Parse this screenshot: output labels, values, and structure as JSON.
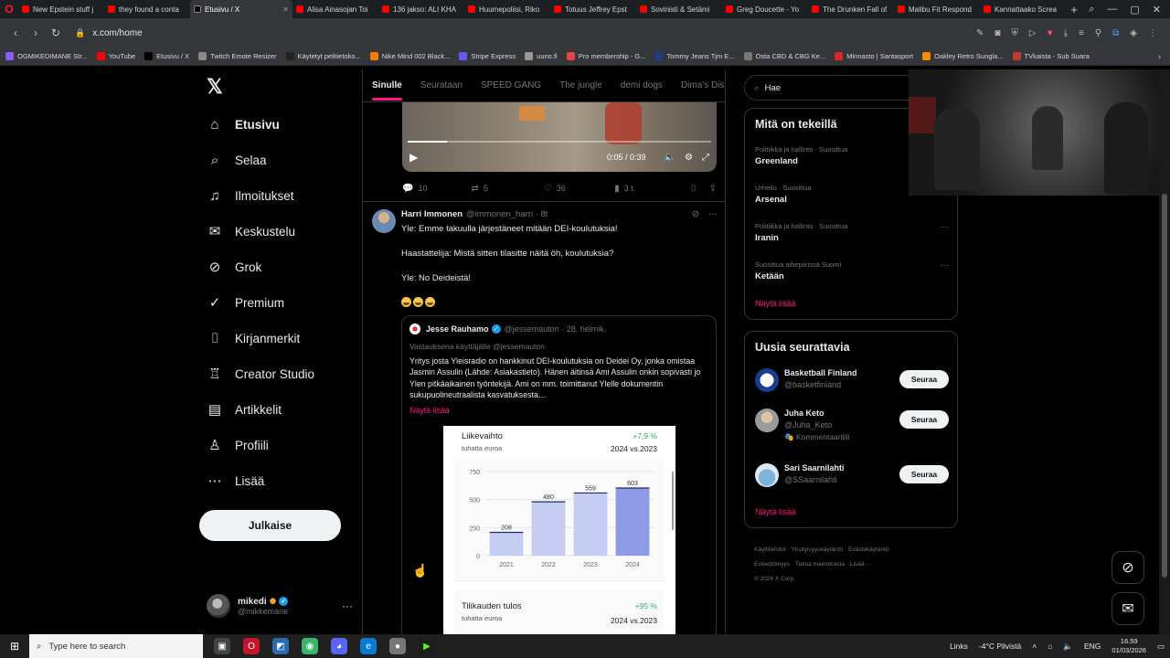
{
  "browser": {
    "tabs": [
      {
        "title": "New Epstein stuff j",
        "favicon": "youtube-icon",
        "active": false
      },
      {
        "title": "they found a conta",
        "favicon": "youtube-icon",
        "active": false
      },
      {
        "title": "Etusivu / X",
        "favicon": "x-icon",
        "active": true
      },
      {
        "title": "Alisa Ainasojan Toi",
        "favicon": "youtube-icon",
        "active": false
      },
      {
        "title": "136 jakso: ALI KHA",
        "favicon": "youtube-icon",
        "active": false
      },
      {
        "title": "Huumepoliisi, Riko",
        "favicon": "youtube-icon",
        "active": false
      },
      {
        "title": "Totuus Jeffrey Epst",
        "favicon": "youtube-icon",
        "active": false
      },
      {
        "title": "Sovinisti & Setämi",
        "favicon": "youtube-icon",
        "active": false
      },
      {
        "title": "Greg Doucette - Yo",
        "favicon": "youtube-icon",
        "active": false
      },
      {
        "title": "The Drunken Fall of",
        "favicon": "youtube-icon",
        "active": false
      },
      {
        "title": "Malibu Fit Respond",
        "favicon": "youtube-icon",
        "active": false
      },
      {
        "title": "Kannattaako Screa",
        "favicon": "youtube-icon",
        "active": false
      }
    ],
    "url": "x.com/home",
    "bookmarks": [
      {
        "label": "OGMIKEDIMANE Str...",
        "color": "#8b5cf6"
      },
      {
        "label": "YouTube",
        "color": "#ff0000"
      },
      {
        "label": "Etusivu / X",
        "color": "#000000"
      },
      {
        "label": "Twitch Emote Resizer",
        "color": "#8a8a8a"
      },
      {
        "label": "Käytetyt pelitietoko...",
        "color": "#222222"
      },
      {
        "label": "Nike Mind 002 Black...",
        "color": "#ff7a00"
      },
      {
        "label": "Stripe Express",
        "color": "#635bff"
      },
      {
        "label": "uuno.fi",
        "color": "#999999"
      },
      {
        "label": "Pro membership - G...",
        "color": "#e04646"
      },
      {
        "label": "Tommy Jeans Tjm E...",
        "color": "#1f3c88"
      },
      {
        "label": "Osta CBD & CBG Ke...",
        "color": "#777777"
      },
      {
        "label": "Minnasto | Santasport",
        "color": "#d62828"
      },
      {
        "label": "Oakley Retro Sungla...",
        "color": "#ff8c00"
      },
      {
        "label": "TVkaista - Sub Suara",
        "color": "#c0392b"
      }
    ]
  },
  "nav": {
    "items": [
      {
        "label": "Etusivu",
        "icon": "home-icon",
        "glyph": "⌂"
      },
      {
        "label": "Selaa",
        "icon": "search-icon",
        "glyph": "⌕"
      },
      {
        "label": "Ilmoitukset",
        "icon": "bell-icon",
        "glyph": "♫"
      },
      {
        "label": "Keskustelu",
        "icon": "envelope-icon",
        "glyph": "✉"
      },
      {
        "label": "Grok",
        "icon": "grok-icon",
        "glyph": "⊘"
      },
      {
        "label": "Premium",
        "icon": "verified-icon",
        "glyph": "✓"
      },
      {
        "label": "Kirjanmerkit",
        "icon": "bookmark-icon",
        "glyph": "⌷"
      },
      {
        "label": "Creator Studio",
        "icon": "creator-icon",
        "glyph": "♖"
      },
      {
        "label": "Artikkelit",
        "icon": "article-icon",
        "glyph": "▤"
      },
      {
        "label": "Profiili",
        "icon": "profile-icon",
        "glyph": "♙"
      },
      {
        "label": "Lisää",
        "icon": "more-circle-icon",
        "glyph": "⋯"
      }
    ],
    "post_button": "Julkaise",
    "user": {
      "name": "mikedi",
      "handle": "@mikkemane"
    }
  },
  "feed": {
    "tabs": [
      "Sinulle",
      "Seurataan",
      "SPEED GANG",
      "The jungle",
      "demi dogs",
      "Dima's Dist"
    ],
    "video": {
      "time": "0:05 / 0:39",
      "progress": 0.13
    },
    "prev_actions": {
      "replies": "10",
      "reposts": "5",
      "likes": "36",
      "views": "3 t."
    },
    "tweet": {
      "name": "Harri Immonen",
      "handle": "@immonen_harri · 8t",
      "lines": [
        "Yle: Emme takuulla järjestäneet mitään DEI-koulutuksia!",
        "Haastattelija: Mistä sitten tilasitte näitä öh, koulutuksia?",
        "Yle: No Deideistä!"
      ],
      "quote": {
        "name": "Jesse Rauhamo",
        "handle": "@jessemauton · 28. helmik.",
        "replying": "Vastauksena käyttäjälle @jessemauton",
        "text": "Yritys josta Yleisradio on hankkinut DEI-koulutuksia on Deidei Oy, jonka omistaa Jasmin Assulin (Lähde: Asiakastieto). Hänen äitinsä Ami Assulin onkin sopivasti jo Ylen pitkäaikainen työntekijä. Ami on mm. toimittanut Ylelle dokumentin sukupuolineutraalista kasvatuksesta…",
        "show_more": "Näytä lisää"
      }
    }
  },
  "chart_data": {
    "type": "bar",
    "title": "Liikevaihto",
    "unit": "tuhatta euroa",
    "growth": "+7,9 %",
    "period": "2024 vs.2023",
    "categories": [
      "2021",
      "2022",
      "2023",
      "2024"
    ],
    "values": [
      208,
      480,
      559,
      603
    ],
    "yticks": [
      0,
      250,
      500,
      750
    ],
    "ylim": [
      0,
      750
    ],
    "colors": [
      "#c5cdf3",
      "#c5cdf3",
      "#c5cdf3",
      "#8f9ae6"
    ],
    "second_card": {
      "title": "Tilikauden tulos",
      "unit": "tuhatta euroa",
      "growth": "+95 %",
      "period": "2024 vs.2023"
    }
  },
  "sidebar": {
    "search_value": "Hae",
    "trends_title": "Mitä on tekeillä",
    "trends": [
      {
        "meta": "Politiikka ja hallinto · Suosittua",
        "name": "Greenland"
      },
      {
        "meta": "Urheilu · Suosittua",
        "name": "Arsenal"
      },
      {
        "meta": "Politiikka ja hallinto · Suosittua",
        "name": "Iranin"
      },
      {
        "meta": "Suosittua aihepiirissä Suomi",
        "name": "Ketään"
      }
    ],
    "show_more": "Näytä lisää",
    "follow_title": "Uusia seurattavia",
    "follow": [
      {
        "name": "Basketball Finland",
        "handle": "@basketfinland",
        "extra": ""
      },
      {
        "name": "Juha Keto",
        "handle": "@Juha_Keto",
        "extra": "Kommentaaritili"
      },
      {
        "name": "Sari Saarnilahti",
        "handle": "@SSaarnilahti",
        "extra": ""
      }
    ],
    "follow_button": "Seuraa",
    "footer": [
      "Käyttöehdot",
      "Yksityisyyskäytäntö",
      "Evästekäytäntö",
      "Esteettömyys",
      "Tietoa mainoksista",
      "Lisää ···",
      "© 2026 X Corp."
    ]
  },
  "taskbar": {
    "search_placeholder": "Type here to search",
    "links": "Links",
    "weather": "-4°C  Pilvistä",
    "lang": "ENG",
    "time": "16.59",
    "date": "01/03/2026"
  },
  "colors": {
    "accent": "#f91880",
    "verified": "#1d9bf0",
    "bg": "#000000",
    "border": "#2f3336"
  }
}
